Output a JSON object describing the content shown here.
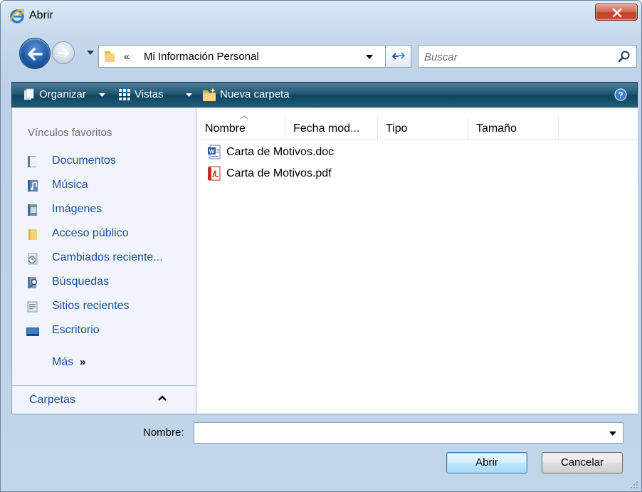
{
  "window": {
    "title": "Abrir"
  },
  "address": {
    "chevrons": "«",
    "path": "Mi Información Personal"
  },
  "search": {
    "placeholder": "Buscar"
  },
  "toolbar": {
    "organize": "Organizar",
    "views": "Vistas",
    "new_folder": "Nueva carpeta"
  },
  "sidebar": {
    "header": "Vínculos favoritos",
    "items": [
      {
        "label": "Documentos",
        "icon": "documents-icon"
      },
      {
        "label": "Música",
        "icon": "music-icon"
      },
      {
        "label": "Imágenes",
        "icon": "pictures-icon"
      },
      {
        "label": "Acceso público",
        "icon": "public-folder-icon"
      },
      {
        "label": "Cambiados reciente...",
        "icon": "recently-changed-icon"
      },
      {
        "label": "Búsquedas",
        "icon": "searches-icon"
      },
      {
        "label": "Sitios recientes",
        "icon": "recent-places-icon"
      },
      {
        "label": "Escritorio",
        "icon": "desktop-icon"
      }
    ],
    "more": "Más",
    "more_arrows": "»",
    "folders": "Carpetas"
  },
  "columns": [
    "Nombre",
    "Fecha mod...",
    "Tipo",
    "Tamaño"
  ],
  "files": [
    {
      "name": "Carta de Motivos.doc",
      "icon": "word-doc-icon"
    },
    {
      "name": "Carta de Motivos.pdf",
      "icon": "pdf-icon"
    }
  ],
  "footer": {
    "name_label": "Nombre:",
    "name_value": "",
    "open_button": "Abrir",
    "cancel_button": "Cancelar"
  },
  "colors": {
    "toolbar": "#1e5672",
    "link": "#1a4f9c",
    "close_button": "#c94f36"
  }
}
